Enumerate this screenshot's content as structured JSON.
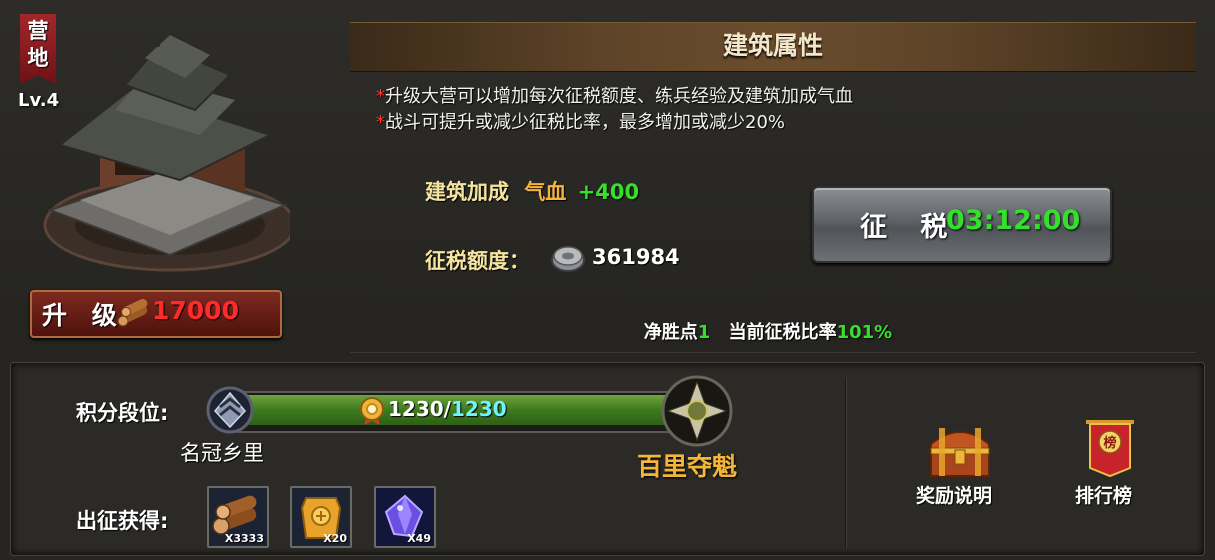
{
  "building": {
    "banner_text": "营地",
    "level": "Lv.4",
    "upgrade_label": "升 级",
    "upgrade_cost": "17000",
    "upgrade_cost_icon": "wood-logs-icon"
  },
  "properties": {
    "title": "建筑属性",
    "desc_lines": [
      "升级大营可以增加每次征税额度、练兵经验及建筑加成气血",
      "战斗可提升或减少征税比率，最多增加或减少20%"
    ],
    "bonus_label": "建筑加成",
    "bonus_stat": "气血",
    "bonus_value": "+400",
    "tax_amount_label": "征税额度：",
    "tax_amount": "361984",
    "tax_amount_icon": "silver-coin-icon",
    "tax_button_label": "征 税",
    "tax_timer": "03:12:00",
    "wins_label": "净胜点",
    "wins_value": "1",
    "rate_label": "当前征税比率",
    "rate_value": "101%"
  },
  "rank": {
    "label": "积分段位:",
    "current": "1230",
    "separator": "/",
    "max": "1230",
    "progress_fraction": 1.0,
    "current_rank_name": "名冠乡里",
    "next_rank_name": "百里夺魁"
  },
  "expedition": {
    "label": "出征获得:",
    "items": [
      {
        "icon": "wood-logs-icon",
        "count": "X3333"
      },
      {
        "icon": "gold-token-icon",
        "count": "X20"
      },
      {
        "icon": "purple-crystal-icon",
        "count": "X49"
      }
    ]
  },
  "side_buttons": {
    "rewards_label": "奖励说明",
    "rewards_icon": "treasure-chest-icon",
    "ranking_label": "排行榜",
    "ranking_icon": "banner-flag-icon"
  },
  "colors": {
    "accent_gold": "#f4b63a",
    "accent_green": "#35e02d",
    "accent_red": "#ff2b2b",
    "accent_cyan": "#6ff3ff"
  }
}
